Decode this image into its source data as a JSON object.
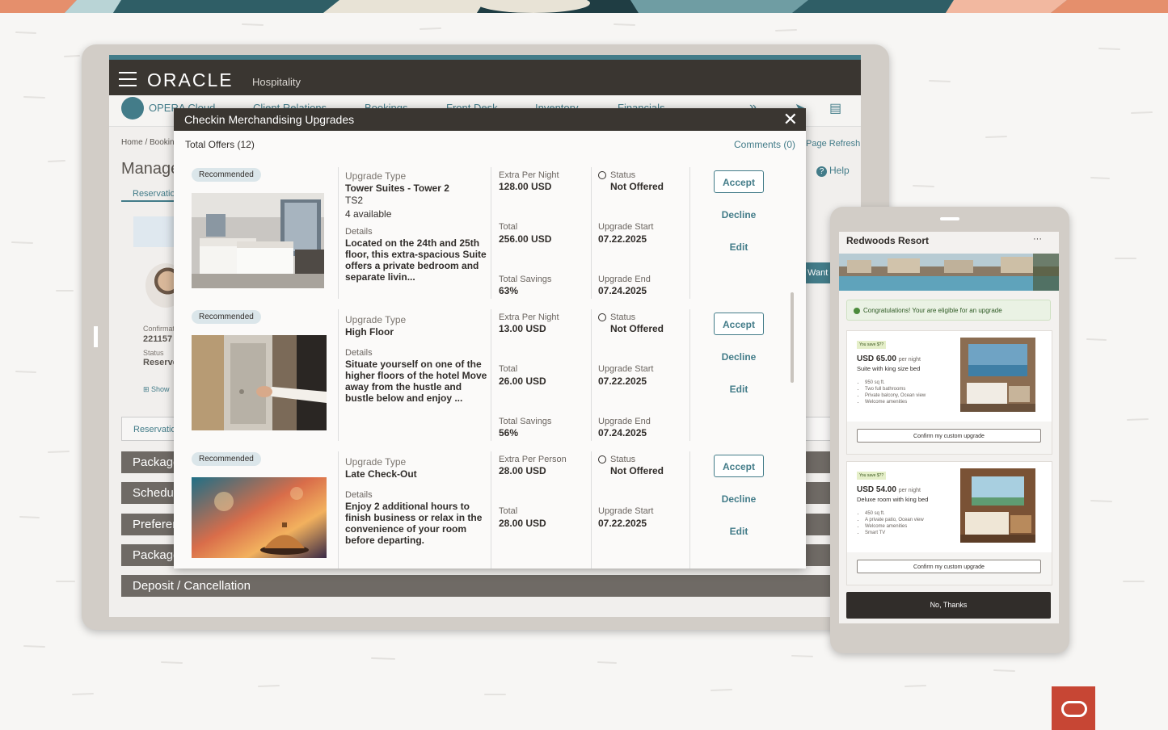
{
  "app": {
    "brand": "ORACLE",
    "product": "Hospitality",
    "nav": [
      "OPERA Cloud",
      "Client Relations",
      "Bookings",
      "Front Desk",
      "Inventory",
      "Financials"
    ],
    "breadcrumb": "Home / Booking",
    "page_title": "Manage",
    "page_refresh": "Page Refresh",
    "help": "Help",
    "reservation_tab": "Reservation",
    "confirmation_label": "Confirmation",
    "confirmation_value": "221157",
    "status_label": "Status",
    "status_value": "Reserved",
    "show_label": "Show",
    "want_tab": "Want T",
    "reservation_link": "Reservation",
    "sections": [
      "Packages",
      "Schedule",
      "Preferences",
      "Packages",
      "Deposit / Cancellation"
    ]
  },
  "dialog": {
    "title": "Checkin Merchandising Upgrades",
    "total_offers": "Total Offers (12)",
    "comments": "Comments (0)",
    "offers": [
      {
        "badge": "Recommended",
        "type_label": "Upgrade Type",
        "type": "Tower Suites - Tower 2",
        "code": "TS2",
        "available": "4 available",
        "details_label": "Details",
        "details": "Located on the 24th and 25th floor, this extra-spacious Suite offers a private bedroom and separate livin...",
        "price_label": "Extra Per Night",
        "price": "128.00 USD",
        "total_label": "Total",
        "total": "256.00 USD",
        "savings_label": "Total Savings",
        "savings": "63%",
        "status_label": "Status",
        "status": "Not Offered",
        "start_label": "Upgrade Start",
        "start": "07.22.2025",
        "end_label": "Upgrade End",
        "end": "07.24.2025",
        "accept": "Accept",
        "decline": "Decline",
        "edit": "Edit"
      },
      {
        "badge": "Recommended",
        "type_label": "Upgrade Type",
        "type": "High Floor",
        "details_label": "Details",
        "details": "Situate yourself on one of the higher floors of the hotel Move away from the hustle and bustle below and enjoy ...",
        "price_label": "Extra Per Night",
        "price": "13.00 USD",
        "total_label": "Total",
        "total": "26.00 USD",
        "savings_label": "Total Savings",
        "savings": "56%",
        "status_label": "Status",
        "status": "Not Offered",
        "start_label": "Upgrade Start",
        "start": "07.22.2025",
        "end_label": "Upgrade End",
        "end": "07.24.2025",
        "accept": "Accept",
        "decline": "Decline",
        "edit": "Edit"
      },
      {
        "badge": "Recommended",
        "type_label": "Upgrade Type",
        "type": "Late Check-Out",
        "details_label": "Details",
        "details": "Enjoy 2 additional hours to finish business or relax in the convenience of your room before departing.",
        "price_label": "Extra Per Person",
        "price": "28.00 USD",
        "total_label": "Total",
        "total": "28.00 USD",
        "status_label": "Status",
        "status": "Not Offered",
        "start_label": "Upgrade Start",
        "start": "07.22.2025",
        "accept": "Accept",
        "decline": "Decline",
        "edit": "Edit"
      }
    ]
  },
  "mobile": {
    "title": "Redwoods Resort",
    "more": "···",
    "congrats": "Congratulations! Your are eligible for an upgrade",
    "cards": [
      {
        "save": "You save $??",
        "price": "USD 65.00",
        "per": "per night",
        "room": "Suite with king size bed",
        "features": [
          "950 sq ft.",
          "Two full bathrooms",
          "Private balcony, Ocean view",
          "Welcome amenities"
        ],
        "confirm": "Confirm my custom upgrade"
      },
      {
        "save": "You save $??",
        "price": "USD 54.00",
        "per": "per night",
        "room": "Deluxe room with king bed",
        "features": [
          "450 sq ft.",
          "A private patio, Ocean view",
          "Welcome amenities",
          "Smart TV"
        ],
        "confirm": "Confirm my custom upgrade"
      }
    ],
    "no_thanks": "No, Thanks"
  },
  "colors": {
    "teal": "#437c89",
    "dark": "#312d2a",
    "oracle_red": "#c74634"
  }
}
